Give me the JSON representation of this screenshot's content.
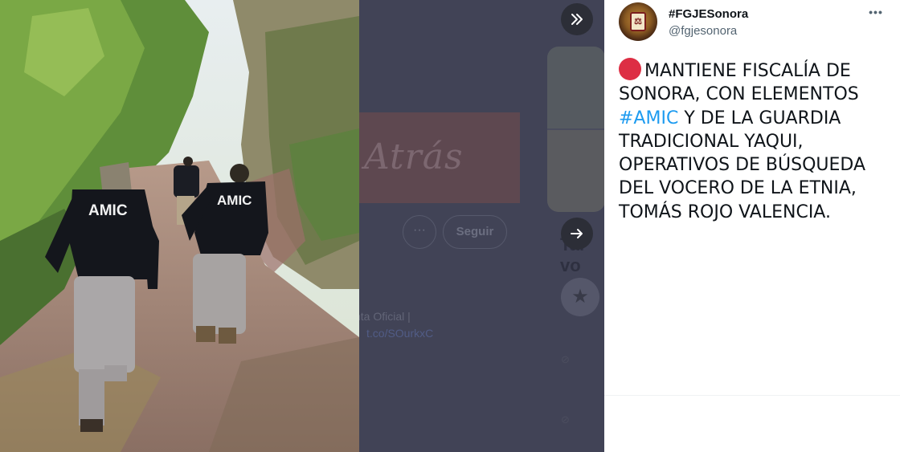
{
  "tweet": {
    "display_name": "#FGJESonora",
    "handle": "@fgjesonora",
    "more_icon": "more-horizontal-icon",
    "status_emoji": "red-circle-icon",
    "text_before": "MANTIENE FISCALÍA DE SONORA, CON ELEMENTOS ",
    "hashtag": "#AMIC",
    "text_after": " Y DE LA GUARDIA TRADICIONAL YAQUI, OPERATIVOS DE BÚSQUEDA DEL VOCERO DE LA ETNIA, TOMÁS ROJO VALENCIA.",
    "hashtag_color": "#1d9bf0"
  },
  "photo": {
    "vest_text_1": "AMIC",
    "vest_text_2": "AMIC"
  },
  "background_page": {
    "banner_text": "Atrás",
    "dots_label": "···",
    "follow_button": "Seguir",
    "line1": "nta Oficial |",
    "line2": "t.co/SOurkxC",
    "partial_heading": "Tal vo",
    "overlay_color": "#414356"
  },
  "viewer": {
    "collapse_icon": "chevrons-right-icon",
    "next_icon": "arrow-right-icon"
  }
}
